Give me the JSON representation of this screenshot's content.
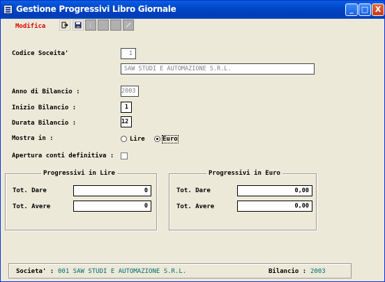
{
  "window": {
    "title": "Gestione Progressivi Libro Giornale"
  },
  "titlebar_buttons": {
    "minimize": "_",
    "maximize": "□",
    "close": "X"
  },
  "toolbar": {
    "mode": "Modifica",
    "buttons": [
      "exit-icon",
      "save-icon",
      "info-icon",
      "blank-icon",
      "blank-icon",
      "edit-icon"
    ]
  },
  "form": {
    "company_code_label": "Codice Soceita'",
    "company_code": "1",
    "company_name": "SAW STUDI E AUTOMAZIONE S.R.L.",
    "fiscal_year_label": "Anno di Bilancio :",
    "fiscal_year": "2003",
    "start_label": "Inizio Bilancio :",
    "start": "1",
    "duration_label": "Durata Bilancio :",
    "duration": "12",
    "show_in_label": "Mostra in :",
    "show_in_options": [
      "Lire",
      "Euro"
    ],
    "show_in_selected": "Euro",
    "final_opening_label": "Apertura conti definitiva :"
  },
  "lire_group": {
    "title": "Progressivi in Lire",
    "dare_label": "Tot. Dare",
    "dare_value": "0",
    "avere_label": "Tot. Avere",
    "avere_value": "0"
  },
  "euro_group": {
    "title": "Progressivi in Euro",
    "dare_label": "Tot. Dare",
    "dare_value": "0,00",
    "avere_label": "Tot. Avere",
    "avere_value": "0,00"
  },
  "status": {
    "company_label": "Societa' :",
    "company_value": "001 SAW STUDI E AUTOMAZIONE S.R.L.",
    "year_label": "Bilancio :",
    "year_value": "2003"
  },
  "colors": {
    "titlebar": "#0047cc",
    "mode_label": "#e00000",
    "status_value": "#006b74",
    "background": "#ece9d8"
  }
}
